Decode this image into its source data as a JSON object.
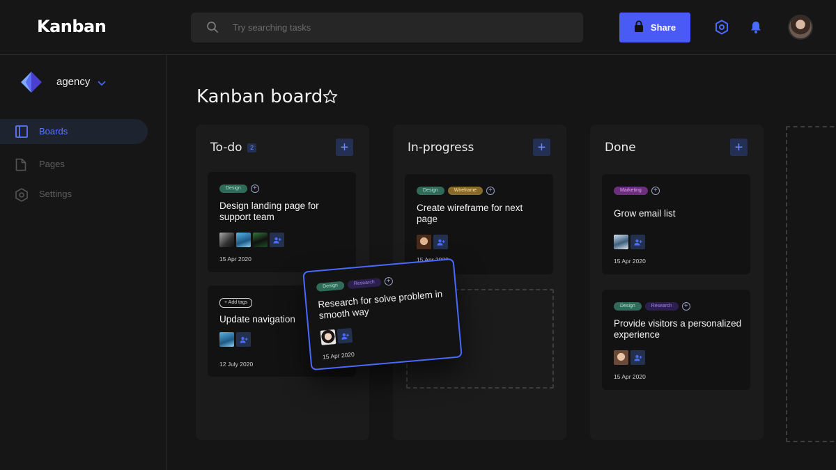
{
  "app": {
    "title": "Kanban"
  },
  "search": {
    "placeholder": "Try searching tasks"
  },
  "header": {
    "share_label": "Share"
  },
  "workspace": {
    "name": "agency"
  },
  "sidebar": {
    "items": [
      {
        "label": "Boards",
        "icon": "board-icon",
        "active": true
      },
      {
        "label": "Pages",
        "icon": "page-icon",
        "active": false
      },
      {
        "label": "Settings",
        "icon": "hexagon-settings-icon",
        "active": false
      }
    ]
  },
  "board": {
    "title": "Kanban board",
    "columns": [
      {
        "title": "To-do",
        "count": "2",
        "cards": [
          {
            "tags": [
              "Design"
            ],
            "title": "Design landing page for support team",
            "date": "15 Apr 2020"
          },
          {
            "tags": [
              "+ Add tags"
            ],
            "title": "Update navigation",
            "date": "12 July 2020"
          }
        ]
      },
      {
        "title": "In-progress",
        "cards": [
          {
            "tags": [
              "Design",
              "Wireframe"
            ],
            "title": "Create wireframe for next page",
            "date": "15 Apr 2020"
          }
        ]
      },
      {
        "title": "Done",
        "cards": [
          {
            "tags": [
              "Marketing"
            ],
            "title": "Grow email list",
            "date": "15 Apr 2020"
          },
          {
            "tags": [
              "Design",
              "Research"
            ],
            "title": "Provide visitors a personalized experience",
            "date": "15 Apr 2020"
          }
        ]
      }
    ],
    "dragging_card": {
      "tags": [
        "Design",
        "Research"
      ],
      "title": "Research for solve problem in smooth way",
      "date": "15 Apr 2020"
    }
  },
  "colors": {
    "accent": "#4a5bf5",
    "background": "#151515",
    "card": "#121212"
  }
}
